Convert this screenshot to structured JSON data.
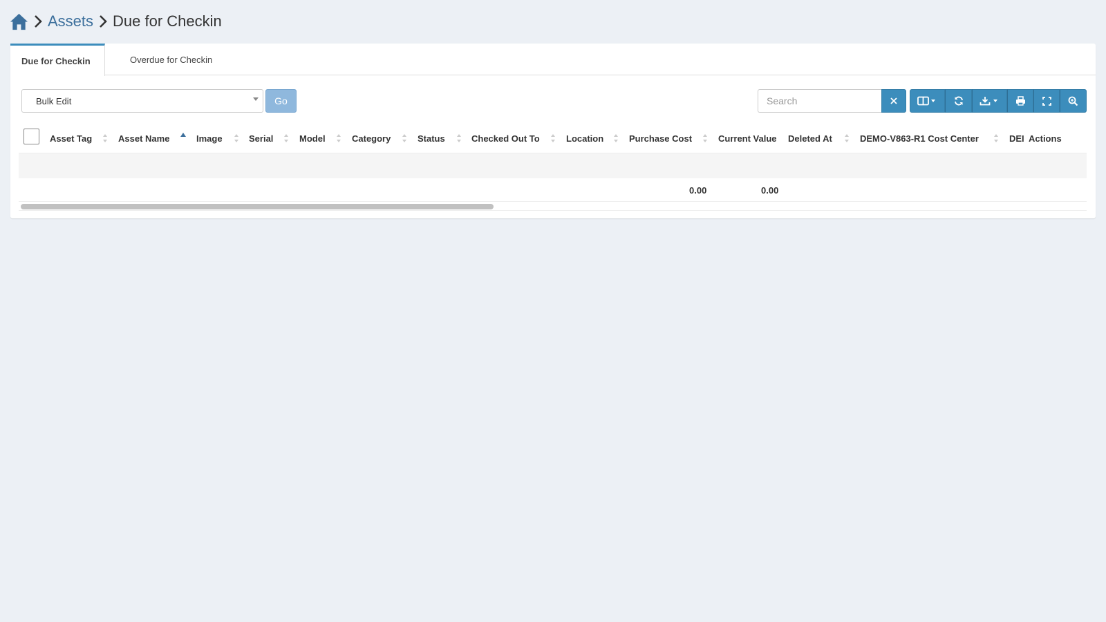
{
  "breadcrumb": {
    "home_icon": "home-icon",
    "section": "Assets",
    "current": "Due for Checkin"
  },
  "tabs": [
    {
      "label": "Due for Checkin",
      "active": true
    },
    {
      "label": "Overdue for Checkin",
      "active": false
    }
  ],
  "toolbar": {
    "bulk_select_value": "Bulk Edit",
    "go_label": "Go",
    "search_placeholder": "Search",
    "buttons": [
      "columns-icon",
      "refresh-icon",
      "export-icon",
      "print-icon",
      "fullscreen-icon",
      "advanced-search-icon"
    ]
  },
  "table": {
    "columns": {
      "asset_tag": "Asset Tag",
      "asset_name": "Asset Name",
      "image": "Image",
      "serial": "Serial",
      "model": "Model",
      "category": "Category",
      "status": "Status",
      "checked_out_to": "Checked Out To",
      "location": "Location",
      "purchase_cost": "Purchase Cost",
      "current_value": "Current Value",
      "deleted_at": "Deleted At",
      "cost_center": "DEMO-V863-R1 Cost Center",
      "truncated": "DEI",
      "actions": "Actions"
    },
    "sorted_column": "asset_name",
    "sort_direction": "asc",
    "rows": [],
    "footer": {
      "purchase_cost_total": "0.00",
      "current_value_total": "0.00"
    }
  },
  "colors": {
    "background": "#ecf0f5",
    "primary": "#3c8dbc",
    "link": "#3c6f9c",
    "disabled_button": "#8fb8dd"
  }
}
